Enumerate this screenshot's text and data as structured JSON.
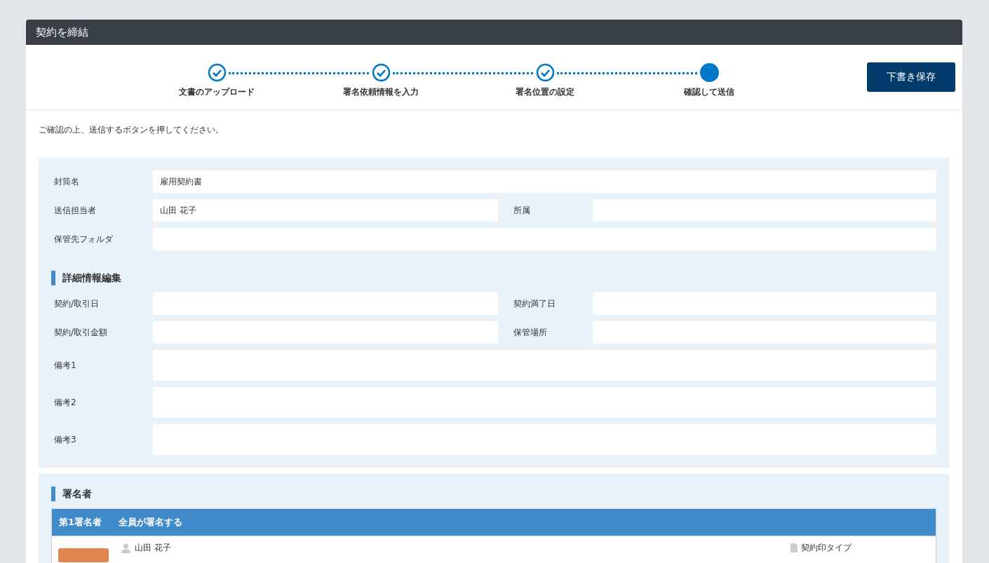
{
  "window": {
    "title": "契約を締結"
  },
  "steps": [
    {
      "label": "文書のアップロード",
      "completed": true
    },
    {
      "label": "署名依頼情報を入力",
      "completed": true
    },
    {
      "label": "署名位置の設定",
      "completed": true
    },
    {
      "label": "確認して送信",
      "completed": false
    }
  ],
  "draft_button": "下書き保存",
  "instruction": "ご確認の上、送信するボタンを押してください。",
  "basic_rows": [
    [
      {
        "label": "封筒名",
        "value": "雇用契約書",
        "kind": "text"
      }
    ],
    [
      {
        "label": "送信担当者",
        "value": "山田 花子",
        "kind": "text"
      },
      {
        "label": "所属",
        "kind": "text"
      }
    ],
    [
      {
        "label": "保管先フォルダ",
        "kind": "text"
      }
    ]
  ],
  "details": {
    "title": "詳細情報編集",
    "rows": [
      [
        {
          "label": "契約/取引日",
          "kind": "text"
        },
        {
          "label": "契約満了日",
          "kind": "text"
        }
      ],
      [
        {
          "label": "契約/取引金額",
          "kind": "text"
        },
        {
          "label": "保管場所",
          "kind": "text"
        }
      ],
      [
        {
          "label": "備考1",
          "kind": "textarea"
        }
      ],
      [
        {
          "label": "備考2",
          "kind": "textarea"
        }
      ],
      [
        {
          "label": "備考3",
          "kind": "textarea"
        }
      ]
    ]
  },
  "signers": {
    "title": "署名者",
    "header": [
      "第1署名者",
      "全員が署名する"
    ],
    "rows": [
      {
        "name": "山田 花子",
        "seal_type": "契約印タイプ"
      }
    ]
  }
}
